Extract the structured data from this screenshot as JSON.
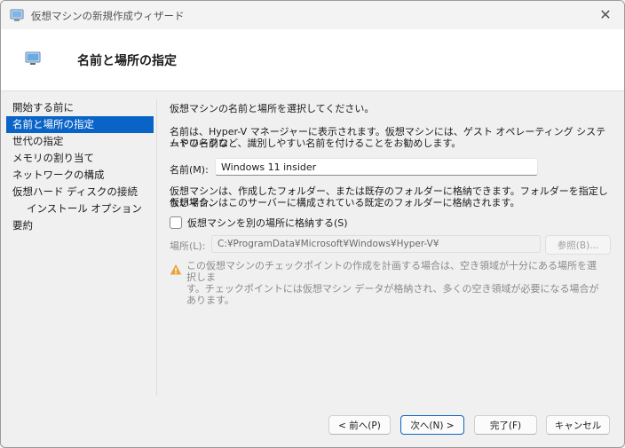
{
  "window": {
    "title": "仮想マシンの新規作成ウィザード",
    "close_glyph": "✕"
  },
  "header": {
    "title": "名前と場所の指定"
  },
  "nav": {
    "items": [
      {
        "label": "開始する前に"
      },
      {
        "label": "名前と場所の指定",
        "active": true
      },
      {
        "label": "世代の指定"
      },
      {
        "label": "メモリの割り当て"
      },
      {
        "label": "ネットワークの構成"
      },
      {
        "label": "仮想ハード ディスクの接続"
      },
      {
        "label": "インストール オプション",
        "sub": true
      },
      {
        "label": "要約"
      }
    ]
  },
  "content": {
    "intro": "仮想マシンの名前と場所を選択してください。",
    "desc_line1": "名前は、Hyper-V マネージャーに表示されます。仮想マシンには、ゲスト オペレーティング システムやワークロ",
    "desc_line2": "ードの名前など、識別しやすい名前を付けることをお勧めします。",
    "name_label": "名前(M):",
    "name_value": "Windows 11 insider",
    "store_line1": "仮想マシンは、作成したフォルダー、または既存のフォルダーに格納できます。フォルダーを指定しない場合、",
    "store_line2": "仮想マシンはこのサーバーに構成されている既定のフォルダーに格納されます。",
    "checkbox_label": "仮想マシンを別の場所に格納する(S)",
    "checkbox_checked": false,
    "location_label": "場所(L):",
    "location_value": "C:¥ProgramData¥Microsoft¥Windows¥Hyper-V¥",
    "browse_label": "参照(B)...",
    "warning_line1": "この仮想マシンのチェックポイントの作成を計画する場合は、空き領域が十分にある場所を選択しま",
    "warning_line2": "す。チェックポイントには仮想マシン データが格納され、多くの空き領域が必要になる場合があります。"
  },
  "footer": {
    "back_label": "< 前へ(P)",
    "next_label": "次へ(N) >",
    "finish_label": "完了(F)",
    "cancel_label": "キャンセル"
  },
  "colors": {
    "accent": "#0a64c8",
    "warning": "#e8a33c"
  }
}
